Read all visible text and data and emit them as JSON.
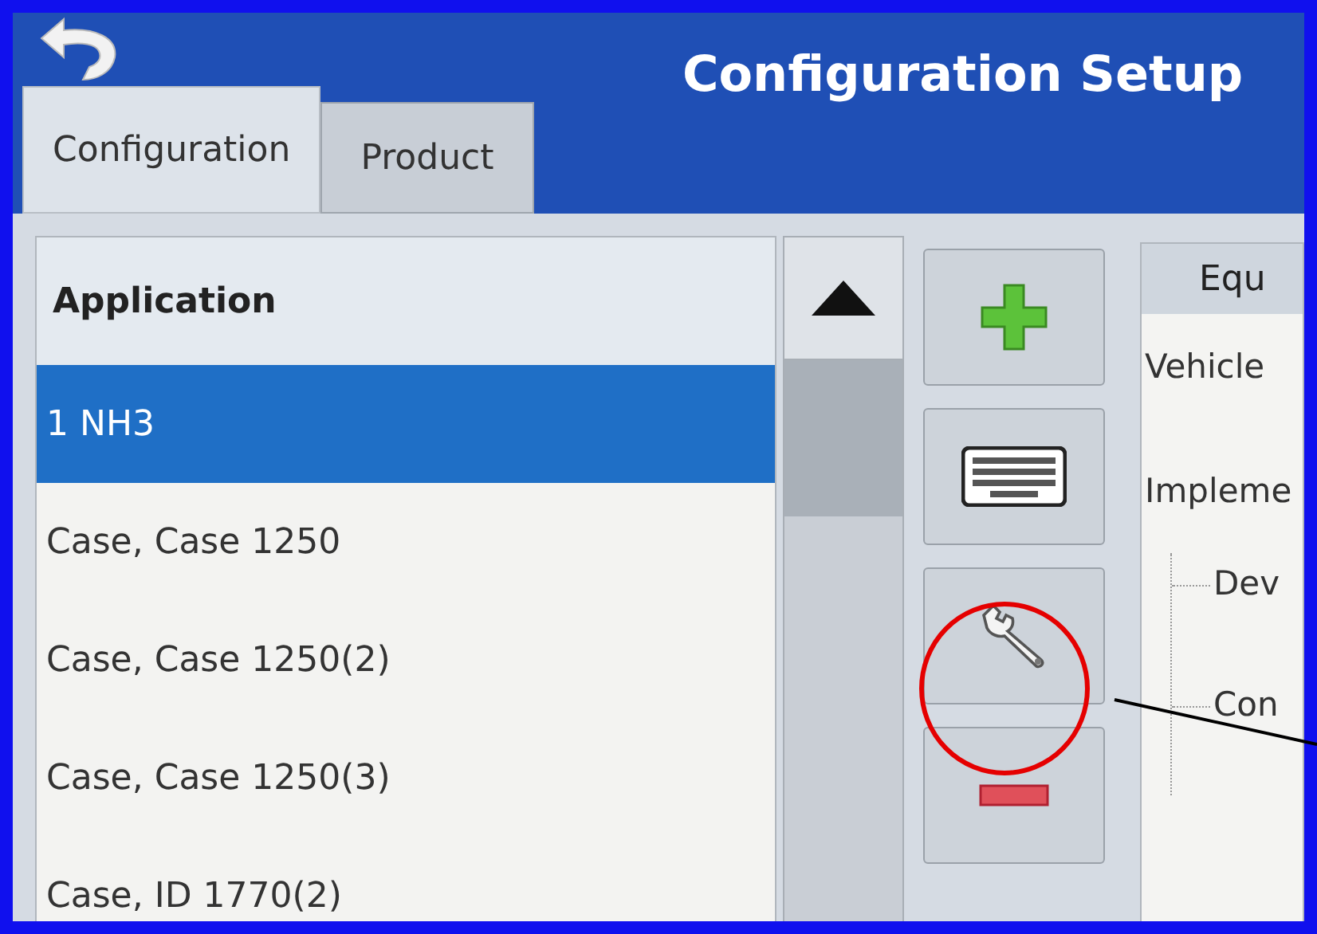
{
  "window": {
    "title": "Configuration Setup"
  },
  "tabs": [
    {
      "label": "Configuration",
      "selected": true
    },
    {
      "label": "Product",
      "selected": false
    }
  ],
  "application_list": {
    "header": "Application",
    "rows": [
      {
        "label": "1 NH3",
        "selected": true
      },
      {
        "label": "Case, Case 1250",
        "selected": false
      },
      {
        "label": "Case, Case 1250(2)",
        "selected": false
      },
      {
        "label": "Case, Case 1250(3)",
        "selected": false
      },
      {
        "label": "Case, ID 1770(2)",
        "selected": false
      }
    ]
  },
  "actions": [
    {
      "kind": "add"
    },
    {
      "kind": "keyboard"
    },
    {
      "kind": "wrench"
    },
    {
      "kind": "remove"
    }
  ],
  "equipment_panel": {
    "header": "Equ",
    "items": [
      {
        "label": "Vehicle"
      },
      {
        "label": "Impleme",
        "children": [
          {
            "label": "Dev"
          },
          {
            "label": "Con"
          }
        ]
      }
    ]
  }
}
